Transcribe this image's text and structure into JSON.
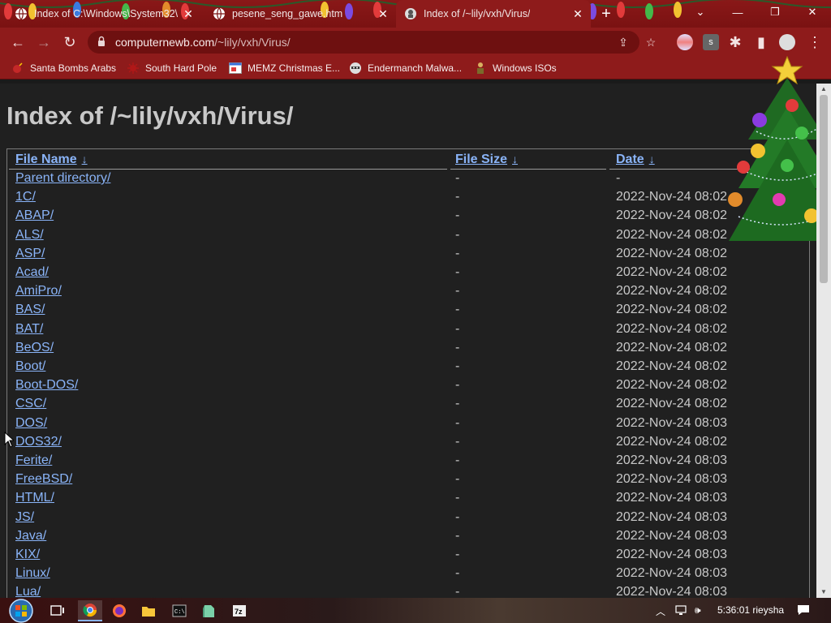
{
  "browser": {
    "tabs": [
      {
        "title": "Index of C:\\Windows\\System32\\",
        "active": false
      },
      {
        "title": "pesene_seng_gawe.htm",
        "active": false
      },
      {
        "title": "Index of /~lily/vxh/Virus/",
        "active": true
      }
    ],
    "address": {
      "host": "computernewb.com",
      "path": "/~lily/vxh/Virus/"
    },
    "bookmarks": [
      {
        "label": "Santa Bombs Arabs"
      },
      {
        "label": "South Hard Pole"
      },
      {
        "label": "MEMZ Christmas E..."
      },
      {
        "label": "Endermanch Malwa..."
      },
      {
        "label": "Windows ISOs"
      }
    ]
  },
  "page": {
    "title": "Index of /~lily/vxh/Virus/",
    "columns": {
      "name": "File Name",
      "size": "File Size",
      "date": "Date",
      "sort_arrow": "↓"
    },
    "entries": [
      {
        "name": "Parent directory/",
        "size": "-",
        "date": "-"
      },
      {
        "name": "1C/",
        "size": "-",
        "date": "2022-Nov-24 08:02"
      },
      {
        "name": "ABAP/",
        "size": "-",
        "date": "2022-Nov-24 08:02"
      },
      {
        "name": "ALS/",
        "size": "-",
        "date": "2022-Nov-24 08:02"
      },
      {
        "name": "ASP/",
        "size": "-",
        "date": "2022-Nov-24 08:02"
      },
      {
        "name": "Acad/",
        "size": "-",
        "date": "2022-Nov-24 08:02"
      },
      {
        "name": "AmiPro/",
        "size": "-",
        "date": "2022-Nov-24 08:02"
      },
      {
        "name": "BAS/",
        "size": "-",
        "date": "2022-Nov-24 08:02"
      },
      {
        "name": "BAT/",
        "size": "-",
        "date": "2022-Nov-24 08:02"
      },
      {
        "name": "BeOS/",
        "size": "-",
        "date": "2022-Nov-24 08:02"
      },
      {
        "name": "Boot/",
        "size": "-",
        "date": "2022-Nov-24 08:02"
      },
      {
        "name": "Boot-DOS/",
        "size": "-",
        "date": "2022-Nov-24 08:02"
      },
      {
        "name": "CSC/",
        "size": "-",
        "date": "2022-Nov-24 08:02"
      },
      {
        "name": "DOS/",
        "size": "-",
        "date": "2022-Nov-24 08:03"
      },
      {
        "name": "DOS32/",
        "size": "-",
        "date": "2022-Nov-24 08:02"
      },
      {
        "name": "Ferite/",
        "size": "-",
        "date": "2022-Nov-24 08:03"
      },
      {
        "name": "FreeBSD/",
        "size": "-",
        "date": "2022-Nov-24 08:03"
      },
      {
        "name": "HTML/",
        "size": "-",
        "date": "2022-Nov-24 08:03"
      },
      {
        "name": "JS/",
        "size": "-",
        "date": "2022-Nov-24 08:03"
      },
      {
        "name": "Java/",
        "size": "-",
        "date": "2022-Nov-24 08:03"
      },
      {
        "name": "KIX/",
        "size": "-",
        "date": "2022-Nov-24 08:03"
      },
      {
        "name": "Linux/",
        "size": "-",
        "date": "2022-Nov-24 08:03"
      },
      {
        "name": "Lua/",
        "size": "-",
        "date": "2022-Nov-24 08:03"
      }
    ]
  },
  "taskbar": {
    "apps": [
      "chrome",
      "firefox",
      "file-explorer",
      "command-prompt",
      "notepad",
      "7zip"
    ],
    "clock": "5:36:01 rieysha"
  },
  "colors": {
    "link": "#8ab4f8",
    "chrome_frame": "#8e1b1b",
    "page_bg": "#202020"
  }
}
